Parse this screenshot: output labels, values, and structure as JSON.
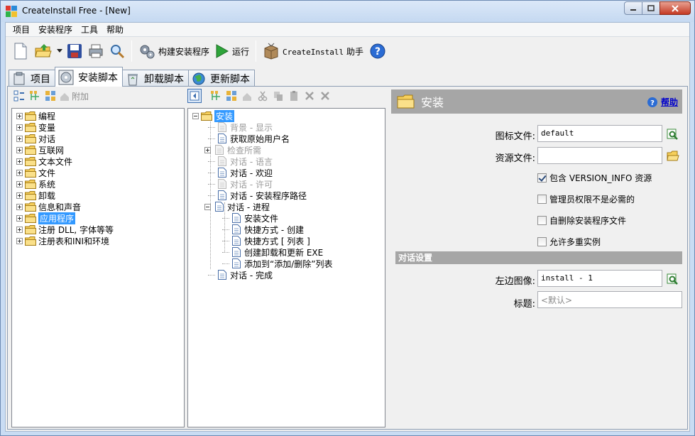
{
  "window": {
    "title": "CreateInstall Free - [New]"
  },
  "menu": {
    "items": [
      "项目",
      "安装程序",
      "工具",
      "帮助"
    ]
  },
  "toolbar": {
    "build_label": "构建安装程序",
    "run_label": "运行",
    "assistant_prefix": "CreateInstall",
    "assistant_suffix": " 助手"
  },
  "tabs": [
    {
      "label": "项目"
    },
    {
      "label": "安装脚本"
    },
    {
      "label": "卸载脚本"
    },
    {
      "label": "更新脚本"
    }
  ],
  "left_tools": {
    "attach_label": "附加"
  },
  "command_tree": {
    "items": [
      {
        "label": "编程"
      },
      {
        "label": "变量"
      },
      {
        "label": "对话"
      },
      {
        "label": "互联网"
      },
      {
        "label": "文本文件"
      },
      {
        "label": "文件"
      },
      {
        "label": "系统"
      },
      {
        "label": "卸载"
      },
      {
        "label": "信息和声音"
      },
      {
        "label": "应用程序"
      },
      {
        "label": "注册 DLL, 字体等等"
      },
      {
        "label": "注册表和INI和环境"
      }
    ],
    "selected_index": 9
  },
  "script_tree": {
    "root": "安装",
    "items": [
      {
        "label": "背景 - 显示",
        "disabled": true,
        "level": 1
      },
      {
        "label": "获取原始用户名",
        "disabled": false,
        "level": 1
      },
      {
        "label": "检查所需",
        "disabled": true,
        "level": 1,
        "expander": true
      },
      {
        "label": "对话 - 语言",
        "disabled": true,
        "level": 1
      },
      {
        "label": "对话 - 欢迎",
        "disabled": false,
        "level": 1
      },
      {
        "label": "对话 - 许可",
        "disabled": true,
        "level": 1
      },
      {
        "label": "对话 - 安装程序路径",
        "disabled": false,
        "level": 1
      },
      {
        "label": "对话 - 进程",
        "disabled": false,
        "level": 1,
        "expander": true,
        "expanded": true
      },
      {
        "label": "安装文件",
        "disabled": false,
        "level": 2
      },
      {
        "label": "快捷方式 - 创建",
        "disabled": false,
        "level": 2
      },
      {
        "label": "快捷方式 [ 列表 ]",
        "disabled": false,
        "level": 2
      },
      {
        "label": "创建卸载和更新 EXE",
        "disabled": false,
        "level": 2
      },
      {
        "label": "添加到“添加/删除”列表",
        "disabled": false,
        "level": 2
      },
      {
        "label": "对话 - 完成",
        "disabled": false,
        "level": 1
      }
    ]
  },
  "properties": {
    "section_title": "安装",
    "help_label": "帮助",
    "icon_file_label": "图标文件:",
    "icon_file_value": "default",
    "resource_file_label": "资源文件:",
    "resource_file_value": "",
    "cb_version_info": "包含 VERSION_INFO 资源",
    "cb_version_info_checked": true,
    "cb_admin": "管理员权限不是必需的",
    "cb_admin_checked": false,
    "cb_self_delete": "自删除安装程序文件",
    "cb_self_delete_checked": false,
    "cb_multi": "允许多重实例",
    "cb_multi_checked": false,
    "dialog_group": "对话设置",
    "left_image_label": "左边图像:",
    "left_image_value": "install - 1",
    "caption_label": "标题:",
    "caption_placeholder": "<默认>"
  }
}
